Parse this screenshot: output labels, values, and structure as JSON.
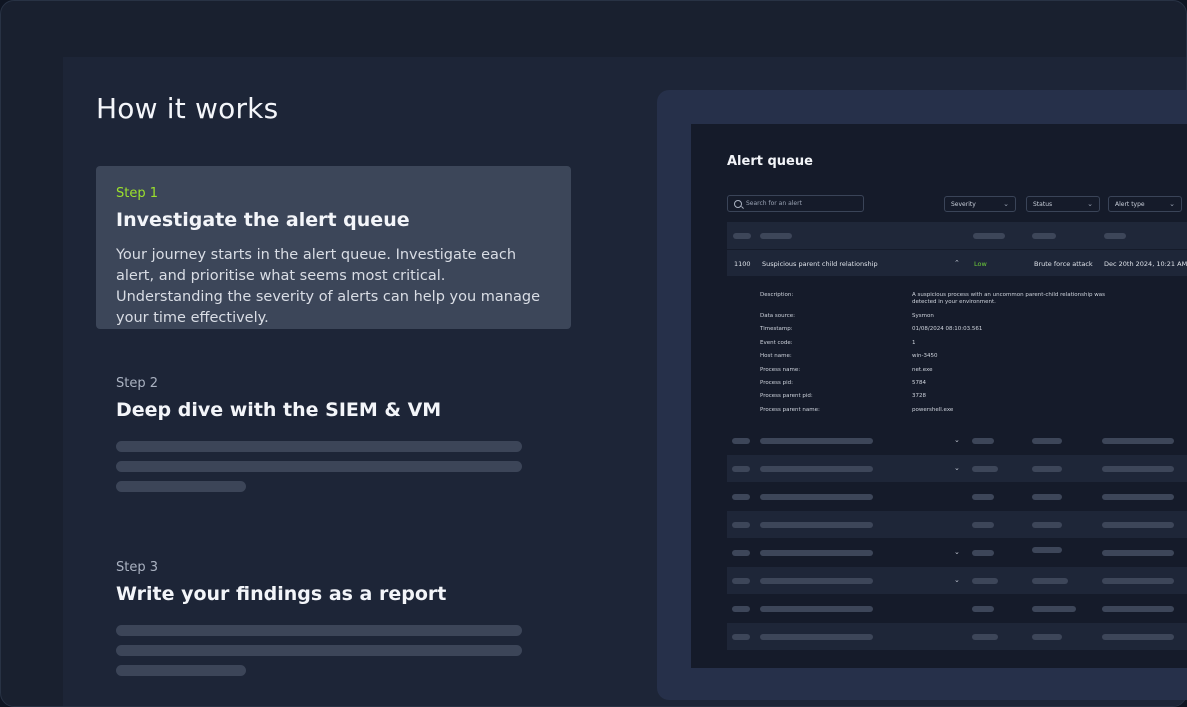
{
  "heading": "How it works",
  "steps": [
    {
      "num": "Step 1",
      "title": "Investigate the alert queue",
      "desc": "Your journey starts in the alert queue. Investigate each alert, and prioritise what seems most critical. Understanding the severity of alerts can help you manage your time effectively."
    },
    {
      "num": "Step 2",
      "title": "Deep dive with the SIEM & VM"
    },
    {
      "num": "Step 3",
      "title": "Write your findings as a report"
    }
  ],
  "queue": {
    "title": "Alert queue",
    "search_placeholder": "Search for an alert",
    "filters": [
      "Severity",
      "Status",
      "Alert type"
    ],
    "alert": {
      "id": "1100",
      "name": "Suspicious parent child relationship",
      "severity": "Low",
      "type": "Brute force attack",
      "date": "Dec 20th 2024, 10:21 AM"
    },
    "details": [
      {
        "k": "Description:",
        "v": "A suspicious process with an uncommon parent-child relationship was detected in your environment."
      },
      {
        "k": "Data source:",
        "v": "Sysmon"
      },
      {
        "k": "Timestamp:",
        "v": "01/08/2024 08:10:03.561"
      },
      {
        "k": "Event code:",
        "v": "1"
      },
      {
        "k": "Host name:",
        "v": "win-3450"
      },
      {
        "k": "Process name:",
        "v": "net.exe"
      },
      {
        "k": "Process pid:",
        "v": "5784"
      },
      {
        "k": "Process parent pid:",
        "v": "3728"
      },
      {
        "k": "Process parent name:",
        "v": "powershell.exe"
      }
    ]
  },
  "colors": {
    "accent": "#9be12c",
    "low": "#6fcf3a",
    "panel": "#151b2a"
  }
}
